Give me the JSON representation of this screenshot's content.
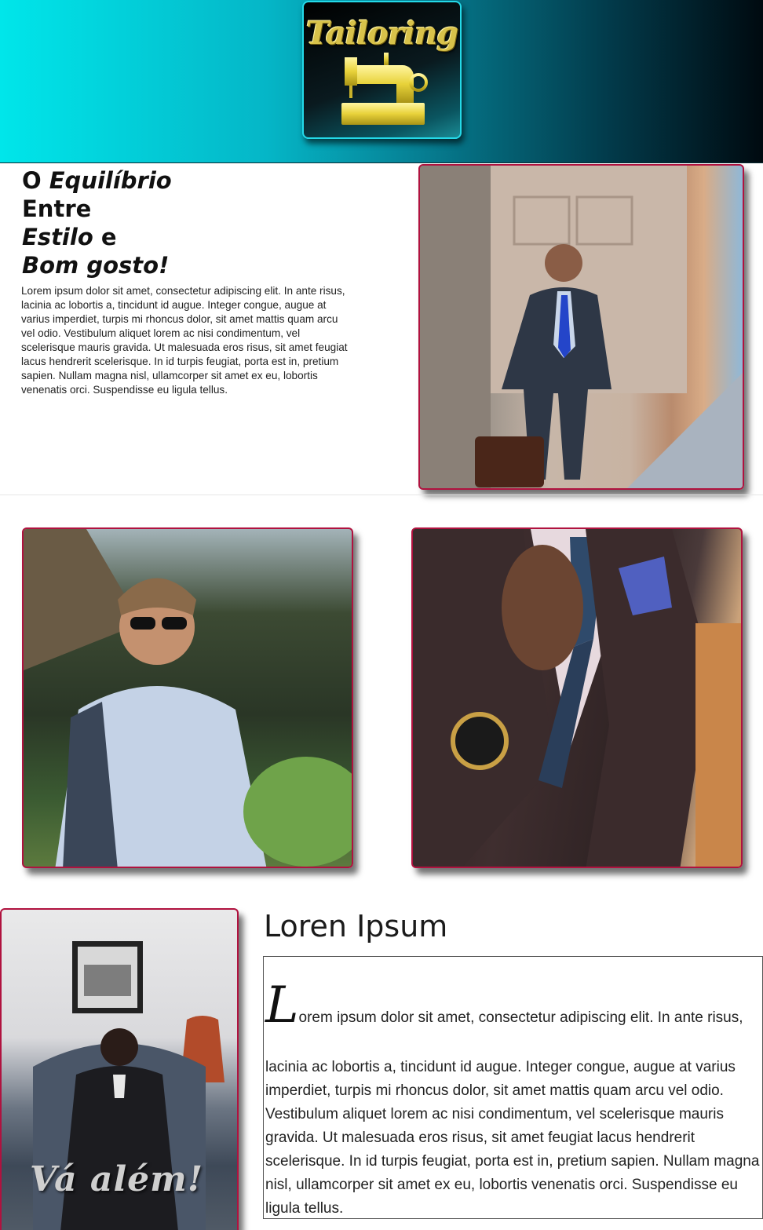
{
  "header": {
    "logo_text": "Tailoring",
    "logo_icon": "sewing-machine-icon"
  },
  "hero": {
    "title_line1_a": "O ",
    "title_line1_b": "Equilíbrio",
    "title_line2": "Entre",
    "title_line3_a": "Estilo",
    "title_line3_b": " e",
    "title_line4": "Bom gosto!",
    "text": "Lorem ipsum dolor sit amet, consectetur adipiscing elit. In ante risus, lacinia ac lobortis a, tincidunt id augue. Integer congue, augue at varius imperdiet, turpis mi rhoncus dolor, sit amet mattis quam arcu vel odio. Vestibulum aliquet lorem ac nisi condimentum, vel scelerisque mauris gravida. Ut malesuada eros risus, sit amet feugiat lacus hendrerit scelerisque. In id turpis feugiat, porta est in, pretium sapien. Nullam magna nisl, ullamcorper sit amet ex eu, lobortis venenatis orci. Suspendisse eu ligula tellus."
  },
  "section3": {
    "title": "Loren Ipsum",
    "drop_cap": "L",
    "first_line": "orem ipsum dolor sit amet, consectetur adipiscing elit. In ante risus,",
    "rest": "lacinia ac lobortis a, tincidunt id augue. Integer congue, augue at varius imperdiet, turpis mi rhoncus dolor, sit amet mattis quam arcu vel odio. Vestibulum aliquet lorem ac nisi condimentum, vel scelerisque mauris gravida. Ut malesuada eros risus, sit amet feugiat lacus hendrerit scelerisque. In id turpis feugiat, porta est in, pretium sapien. Nullam magna nisl, ullamcorper sit amet ex eu, lobortis venenatis orci. Suspendisse eu ligula tellus.",
    "photo_caption": "Vá  além!"
  },
  "colors": {
    "header_start": "#00e6ea",
    "header_end": "#000a10",
    "logo_gold": "#d8c24a",
    "photo_border": "#b0123f"
  }
}
